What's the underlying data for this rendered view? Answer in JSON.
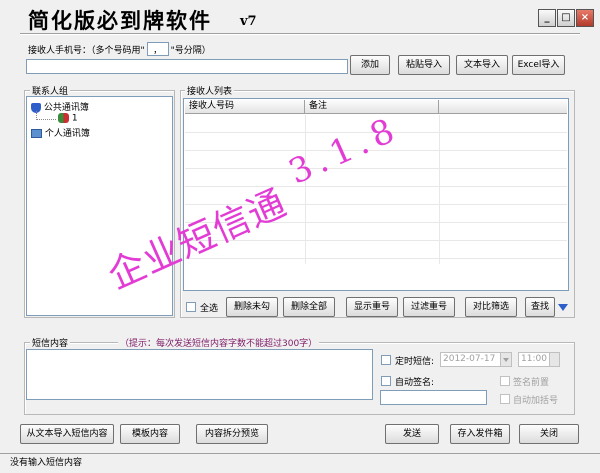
{
  "app": {
    "title": "简化版必到牌软件",
    "version": "v7"
  },
  "window_buttons": {
    "minimize": "_",
    "maximize": "□",
    "close": "×"
  },
  "recipient": {
    "label_before": "接收人手机号：（多个号码用\"",
    "separator": "，",
    "label_after": "\"号分隔）",
    "phone_value": ""
  },
  "top_buttons": {
    "add": "添加",
    "paste_import": "粘贴导入",
    "text_import": "文本导入",
    "excel_import": "Excel导入"
  },
  "contacts": {
    "group_title": "联系人组",
    "tree": [
      {
        "label": "公共通讯簿",
        "icon": "shield-book-icon"
      },
      {
        "label": "1",
        "icon": "group-icon"
      },
      {
        "label": "个人通讯簿",
        "icon": "computer-book-icon"
      }
    ]
  },
  "recipients_list": {
    "group_title": "接收人列表",
    "columns": [
      "接收人号码",
      "备注"
    ],
    "rows": []
  },
  "list_buttons": {
    "select_all": "全选",
    "delete_unchecked": "删除未勾",
    "delete_all": "删除全部",
    "show_duplicates": "显示重号",
    "filter_duplicates": "过滤重号",
    "compare_filter": "对比筛选",
    "find": "查找"
  },
  "sms": {
    "group_title": "短信内容",
    "hint": "（提示：每次发送短信内容字数不能超过300字）",
    "content": ""
  },
  "options": {
    "scheduled_label": "定时短信:",
    "date": "2012-07-17",
    "time": "11:00",
    "auto_sign_label": "自动签名:",
    "signature": "",
    "sign_prefix": "签名前置",
    "auto_bracket": "自动加括号"
  },
  "bottom_buttons": {
    "import_from_text": "从文本导入短信内容",
    "template": "模板内容",
    "split_preview": "内容拆分预览",
    "send": "发送",
    "save_outbox": "存入发件箱",
    "close": "关闭"
  },
  "status": "没有输入短信内容",
  "watermark": {
    "line1": "企业短信通",
    "line2": "3.1.8"
  },
  "colors": {
    "watermark": "#e23cd5",
    "hint": "#80206a"
  }
}
